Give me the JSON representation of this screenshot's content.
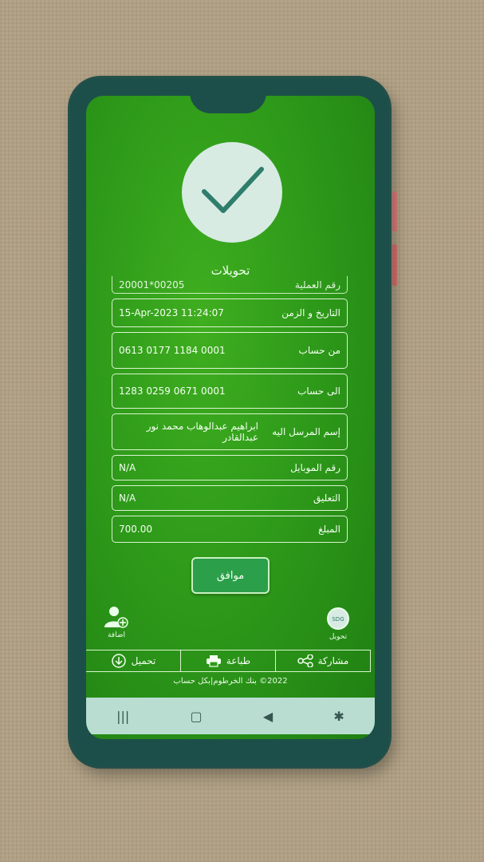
{
  "header": {
    "title": "تحويلات"
  },
  "details": {
    "partial_row": {
      "value": "20001*00205",
      "label": "رقم العملية"
    },
    "rows": [
      {
        "label": "التاريخ و الزمن",
        "value": "15-Apr-2023 11:24:07"
      },
      {
        "label": "من حساب",
        "value": "0613 0177 1184 0001"
      },
      {
        "label": "الى حساب",
        "value": "1283 0259 0671 0001"
      },
      {
        "label": "إسم المرسل اليه",
        "value": "ابراهيم عبدالوهاب محمد نور عبدالقادر"
      },
      {
        "label": "رقم الموبايل",
        "value": "N/A"
      },
      {
        "label": "التعليق",
        "value": "N/A"
      },
      {
        "label": "المبلغ",
        "value": "700.00"
      }
    ]
  },
  "ok_button": {
    "label": "موافق"
  },
  "actions": {
    "add_user": {
      "label": "اضافة",
      "icon": "add-user-icon"
    },
    "transfer": {
      "label": "تحويل",
      "icon": "sdg-coin-icon"
    }
  },
  "toolbar": {
    "share_label": "مشاركة",
    "print_label": "طباعة",
    "download_label": "تحميل"
  },
  "footer": {
    "copyright": "2022© بنك الخرطوم|بكل حساب"
  },
  "colors": {
    "screen_green": "#2e9a1a",
    "border": "#d9f4cf",
    "check_circle": "#d7ebe3",
    "phone_frame": "#1c4f49"
  }
}
